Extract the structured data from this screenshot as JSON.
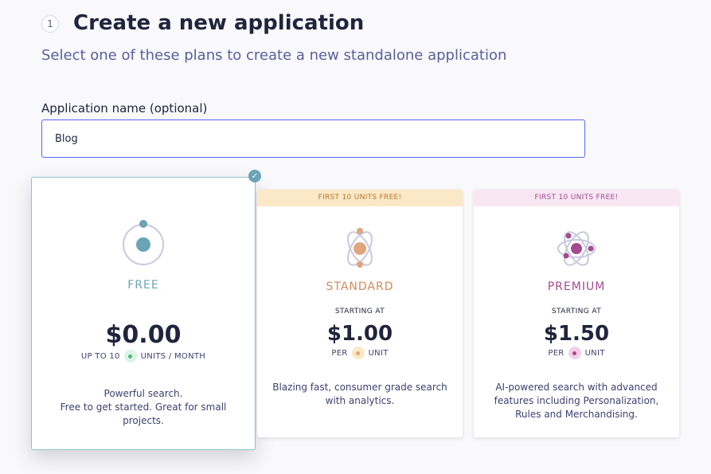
{
  "header": {
    "step_number": "1",
    "title": "Create a new application",
    "subtitle": "Select one of these plans to create a new standalone application"
  },
  "form": {
    "label": "Application name (optional)",
    "value": "Blog"
  },
  "plans": [
    {
      "name": "FREE",
      "selected": true,
      "price": "$0.00",
      "unit_prefix": "UP TO 10",
      "unit_suffix": "UNITS / MONTH",
      "desc_lines": [
        "Powerful search.",
        "Free to get started. Great for small projects."
      ],
      "color": "#6aa4b6"
    },
    {
      "name": "STANDARD",
      "ribbon": "FIRST 10 UNITS FREE!",
      "starting": "STARTING AT",
      "price": "$1.00",
      "unit_prefix": "PER",
      "unit_suffix": "UNIT",
      "desc": "Blazing fast, consumer grade search with analytics.",
      "color": "#d4895a"
    },
    {
      "name": "PREMIUM",
      "ribbon": "FIRST 10 UNITS FREE!",
      "starting": "STARTING AT",
      "price": "$1.50",
      "unit_prefix": "PER",
      "unit_suffix": "UNIT",
      "desc": "AI-powered search with advanced features including Personalization, Rules and Merchandising.",
      "color": "#a34b8e"
    }
  ],
  "colors": {
    "accent": "#5468ff",
    "free": "#6aa4b6",
    "standard": "#d4895a",
    "premium": "#a34b8e"
  },
  "icons": {
    "selected": "check-icon",
    "free": "orbit-icon",
    "standard": "atom-icon",
    "premium": "atom-icon"
  }
}
